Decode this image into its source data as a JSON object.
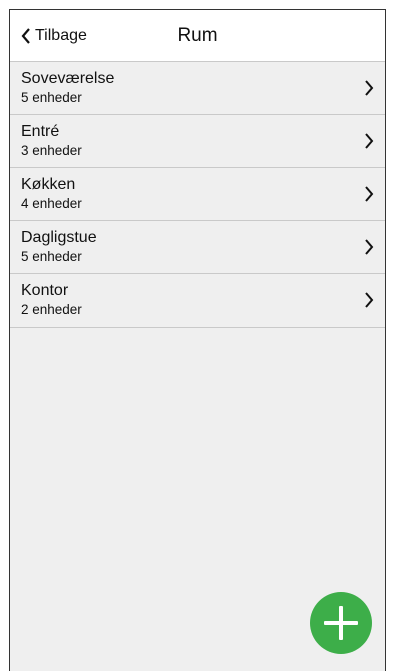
{
  "header": {
    "back_label": "Tilbage",
    "title": "Rum"
  },
  "rooms": [
    {
      "name": "Soveværelse",
      "devices": "5 enheder"
    },
    {
      "name": "Entré",
      "devices": "3 enheder"
    },
    {
      "name": "Køkken",
      "devices": "4 enheder"
    },
    {
      "name": "Dagligstue",
      "devices": "5 enheder"
    },
    {
      "name": "Kontor",
      "devices": "2 enheder"
    }
  ],
  "icons": {
    "back": "chevron-left-icon",
    "row": "chevron-right-icon",
    "add": "plus-icon"
  },
  "colors": {
    "accent": "#3dae49",
    "list_background": "#efefef"
  }
}
